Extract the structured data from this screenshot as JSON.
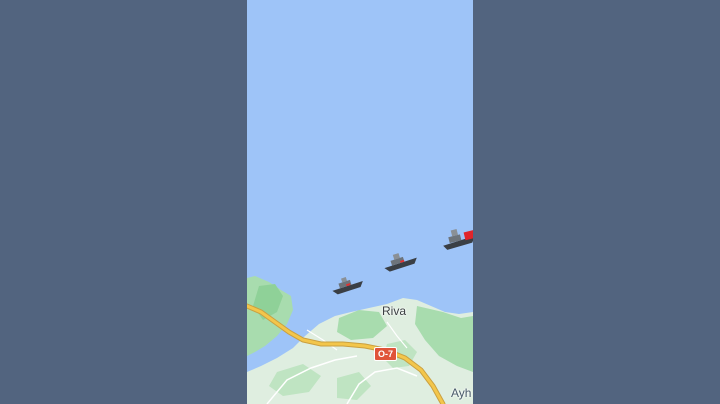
{
  "frame": {
    "letterbox_color": "#52647f",
    "water_color": "#9ec4f8",
    "land_color": "#dfeee0",
    "forest_color": "#a8dcae",
    "highway_color": "#f3c64b"
  },
  "map": {
    "places": [
      {
        "id": "riva",
        "label": "Riva"
      },
      {
        "id": "ayh",
        "label": "Ayh"
      }
    ],
    "roads": [
      {
        "id": "o7",
        "label": "O-7",
        "shield_color": "#e0543a"
      }
    ],
    "ships": [
      {
        "id": "ship-1",
        "icon": "warship-icon"
      },
      {
        "id": "ship-2",
        "icon": "warship-icon"
      },
      {
        "id": "ship-3",
        "icon": "warship-icon",
        "accent": "#e0242a"
      }
    ]
  }
}
